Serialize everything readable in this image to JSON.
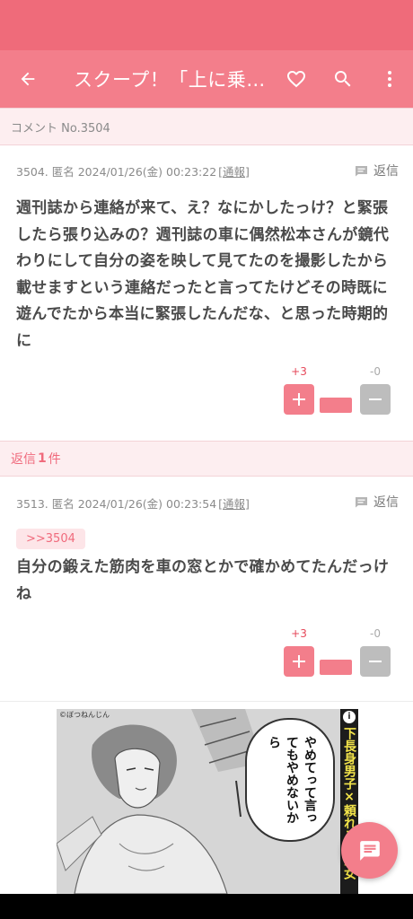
{
  "app_bar": {
    "title": "スクープ！「上に乗…",
    "back_icon": "arrow-back-icon",
    "favorite_icon": "heart-outline-icon",
    "search_icon": "search-icon",
    "menu_icon": "more-vert-icon"
  },
  "comment_section": {
    "label": "コメント No.3504"
  },
  "comment": {
    "meta": "3504. 匿名 2024/01/26(金) 00:23:22",
    "report_label": "[通報]",
    "reply_label": "返信",
    "text": "週刊誌から連絡が来て、え？なにかしたっけ？と緊張したら張り込みの？週刊誌の車に偶然松本さんが鏡代わりにして自分の姿を映して見てたのを撮影したから載せますという連絡だったと言ってたけどその時既に遊んでたから本当に緊張したんだな、と思った時期的に",
    "plus_count": "+3",
    "minus_count": "-0",
    "plus_symbol": "+",
    "minus_symbol": "−"
  },
  "replies_section": {
    "prefix": "返信",
    "count": "1",
    "suffix": "件"
  },
  "reply": {
    "meta": "3513. 匿名 2024/01/26(金) 00:23:54",
    "report_label": "[通報]",
    "reply_label": "返信",
    "anchor": ">>3504",
    "text": "自分の鍛えた筋肉を車の窓とかで確かめてたんだっけね",
    "plus_count": "+3",
    "minus_count": "-0",
    "plus_symbol": "+",
    "minus_symbol": "−"
  },
  "ad": {
    "credit": "©ぼつねんじん",
    "speech": "やめてって言ってもやめないから",
    "side_text": "下長身男子×頼れる先輩女",
    "info_icon": "info-icon"
  },
  "fab": {
    "icon": "chat-bubble-icon"
  },
  "colors": {
    "status_bar": "#ef6b7a",
    "app_bar": "#f37e8b",
    "accent": "#f06a7c",
    "band": "#fdeef0",
    "minus_button": "#bdbdbd"
  }
}
